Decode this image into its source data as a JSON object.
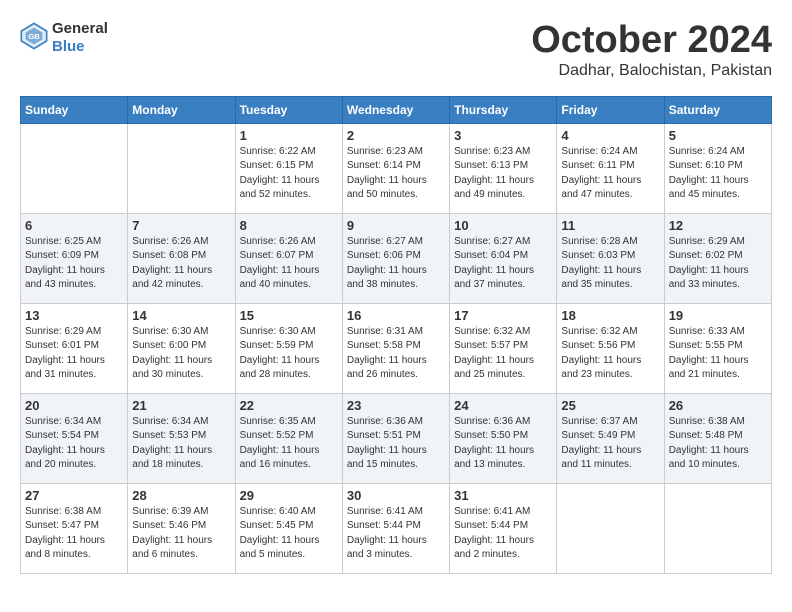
{
  "header": {
    "logo_general": "General",
    "logo_blue": "Blue",
    "month": "October 2024",
    "location": "Dadhar, Balochistan, Pakistan"
  },
  "days_of_week": [
    "Sunday",
    "Monday",
    "Tuesday",
    "Wednesday",
    "Thursday",
    "Friday",
    "Saturday"
  ],
  "weeks": [
    [
      {
        "day": "",
        "info": ""
      },
      {
        "day": "",
        "info": ""
      },
      {
        "day": "1",
        "info": "Sunrise: 6:22 AM\nSunset: 6:15 PM\nDaylight: 11 hours\nand 52 minutes."
      },
      {
        "day": "2",
        "info": "Sunrise: 6:23 AM\nSunset: 6:14 PM\nDaylight: 11 hours\nand 50 minutes."
      },
      {
        "day": "3",
        "info": "Sunrise: 6:23 AM\nSunset: 6:13 PM\nDaylight: 11 hours\nand 49 minutes."
      },
      {
        "day": "4",
        "info": "Sunrise: 6:24 AM\nSunset: 6:11 PM\nDaylight: 11 hours\nand 47 minutes."
      },
      {
        "day": "5",
        "info": "Sunrise: 6:24 AM\nSunset: 6:10 PM\nDaylight: 11 hours\nand 45 minutes."
      }
    ],
    [
      {
        "day": "6",
        "info": "Sunrise: 6:25 AM\nSunset: 6:09 PM\nDaylight: 11 hours\nand 43 minutes."
      },
      {
        "day": "7",
        "info": "Sunrise: 6:26 AM\nSunset: 6:08 PM\nDaylight: 11 hours\nand 42 minutes."
      },
      {
        "day": "8",
        "info": "Sunrise: 6:26 AM\nSunset: 6:07 PM\nDaylight: 11 hours\nand 40 minutes."
      },
      {
        "day": "9",
        "info": "Sunrise: 6:27 AM\nSunset: 6:06 PM\nDaylight: 11 hours\nand 38 minutes."
      },
      {
        "day": "10",
        "info": "Sunrise: 6:27 AM\nSunset: 6:04 PM\nDaylight: 11 hours\nand 37 minutes."
      },
      {
        "day": "11",
        "info": "Sunrise: 6:28 AM\nSunset: 6:03 PM\nDaylight: 11 hours\nand 35 minutes."
      },
      {
        "day": "12",
        "info": "Sunrise: 6:29 AM\nSunset: 6:02 PM\nDaylight: 11 hours\nand 33 minutes."
      }
    ],
    [
      {
        "day": "13",
        "info": "Sunrise: 6:29 AM\nSunset: 6:01 PM\nDaylight: 11 hours\nand 31 minutes."
      },
      {
        "day": "14",
        "info": "Sunrise: 6:30 AM\nSunset: 6:00 PM\nDaylight: 11 hours\nand 30 minutes."
      },
      {
        "day": "15",
        "info": "Sunrise: 6:30 AM\nSunset: 5:59 PM\nDaylight: 11 hours\nand 28 minutes."
      },
      {
        "day": "16",
        "info": "Sunrise: 6:31 AM\nSunset: 5:58 PM\nDaylight: 11 hours\nand 26 minutes."
      },
      {
        "day": "17",
        "info": "Sunrise: 6:32 AM\nSunset: 5:57 PM\nDaylight: 11 hours\nand 25 minutes."
      },
      {
        "day": "18",
        "info": "Sunrise: 6:32 AM\nSunset: 5:56 PM\nDaylight: 11 hours\nand 23 minutes."
      },
      {
        "day": "19",
        "info": "Sunrise: 6:33 AM\nSunset: 5:55 PM\nDaylight: 11 hours\nand 21 minutes."
      }
    ],
    [
      {
        "day": "20",
        "info": "Sunrise: 6:34 AM\nSunset: 5:54 PM\nDaylight: 11 hours\nand 20 minutes."
      },
      {
        "day": "21",
        "info": "Sunrise: 6:34 AM\nSunset: 5:53 PM\nDaylight: 11 hours\nand 18 minutes."
      },
      {
        "day": "22",
        "info": "Sunrise: 6:35 AM\nSunset: 5:52 PM\nDaylight: 11 hours\nand 16 minutes."
      },
      {
        "day": "23",
        "info": "Sunrise: 6:36 AM\nSunset: 5:51 PM\nDaylight: 11 hours\nand 15 minutes."
      },
      {
        "day": "24",
        "info": "Sunrise: 6:36 AM\nSunset: 5:50 PM\nDaylight: 11 hours\nand 13 minutes."
      },
      {
        "day": "25",
        "info": "Sunrise: 6:37 AM\nSunset: 5:49 PM\nDaylight: 11 hours\nand 11 minutes."
      },
      {
        "day": "26",
        "info": "Sunrise: 6:38 AM\nSunset: 5:48 PM\nDaylight: 11 hours\nand 10 minutes."
      }
    ],
    [
      {
        "day": "27",
        "info": "Sunrise: 6:38 AM\nSunset: 5:47 PM\nDaylight: 11 hours\nand 8 minutes."
      },
      {
        "day": "28",
        "info": "Sunrise: 6:39 AM\nSunset: 5:46 PM\nDaylight: 11 hours\nand 6 minutes."
      },
      {
        "day": "29",
        "info": "Sunrise: 6:40 AM\nSunset: 5:45 PM\nDaylight: 11 hours\nand 5 minutes."
      },
      {
        "day": "30",
        "info": "Sunrise: 6:41 AM\nSunset: 5:44 PM\nDaylight: 11 hours\nand 3 minutes."
      },
      {
        "day": "31",
        "info": "Sunrise: 6:41 AM\nSunset: 5:44 PM\nDaylight: 11 hours\nand 2 minutes."
      },
      {
        "day": "",
        "info": ""
      },
      {
        "day": "",
        "info": ""
      }
    ]
  ]
}
